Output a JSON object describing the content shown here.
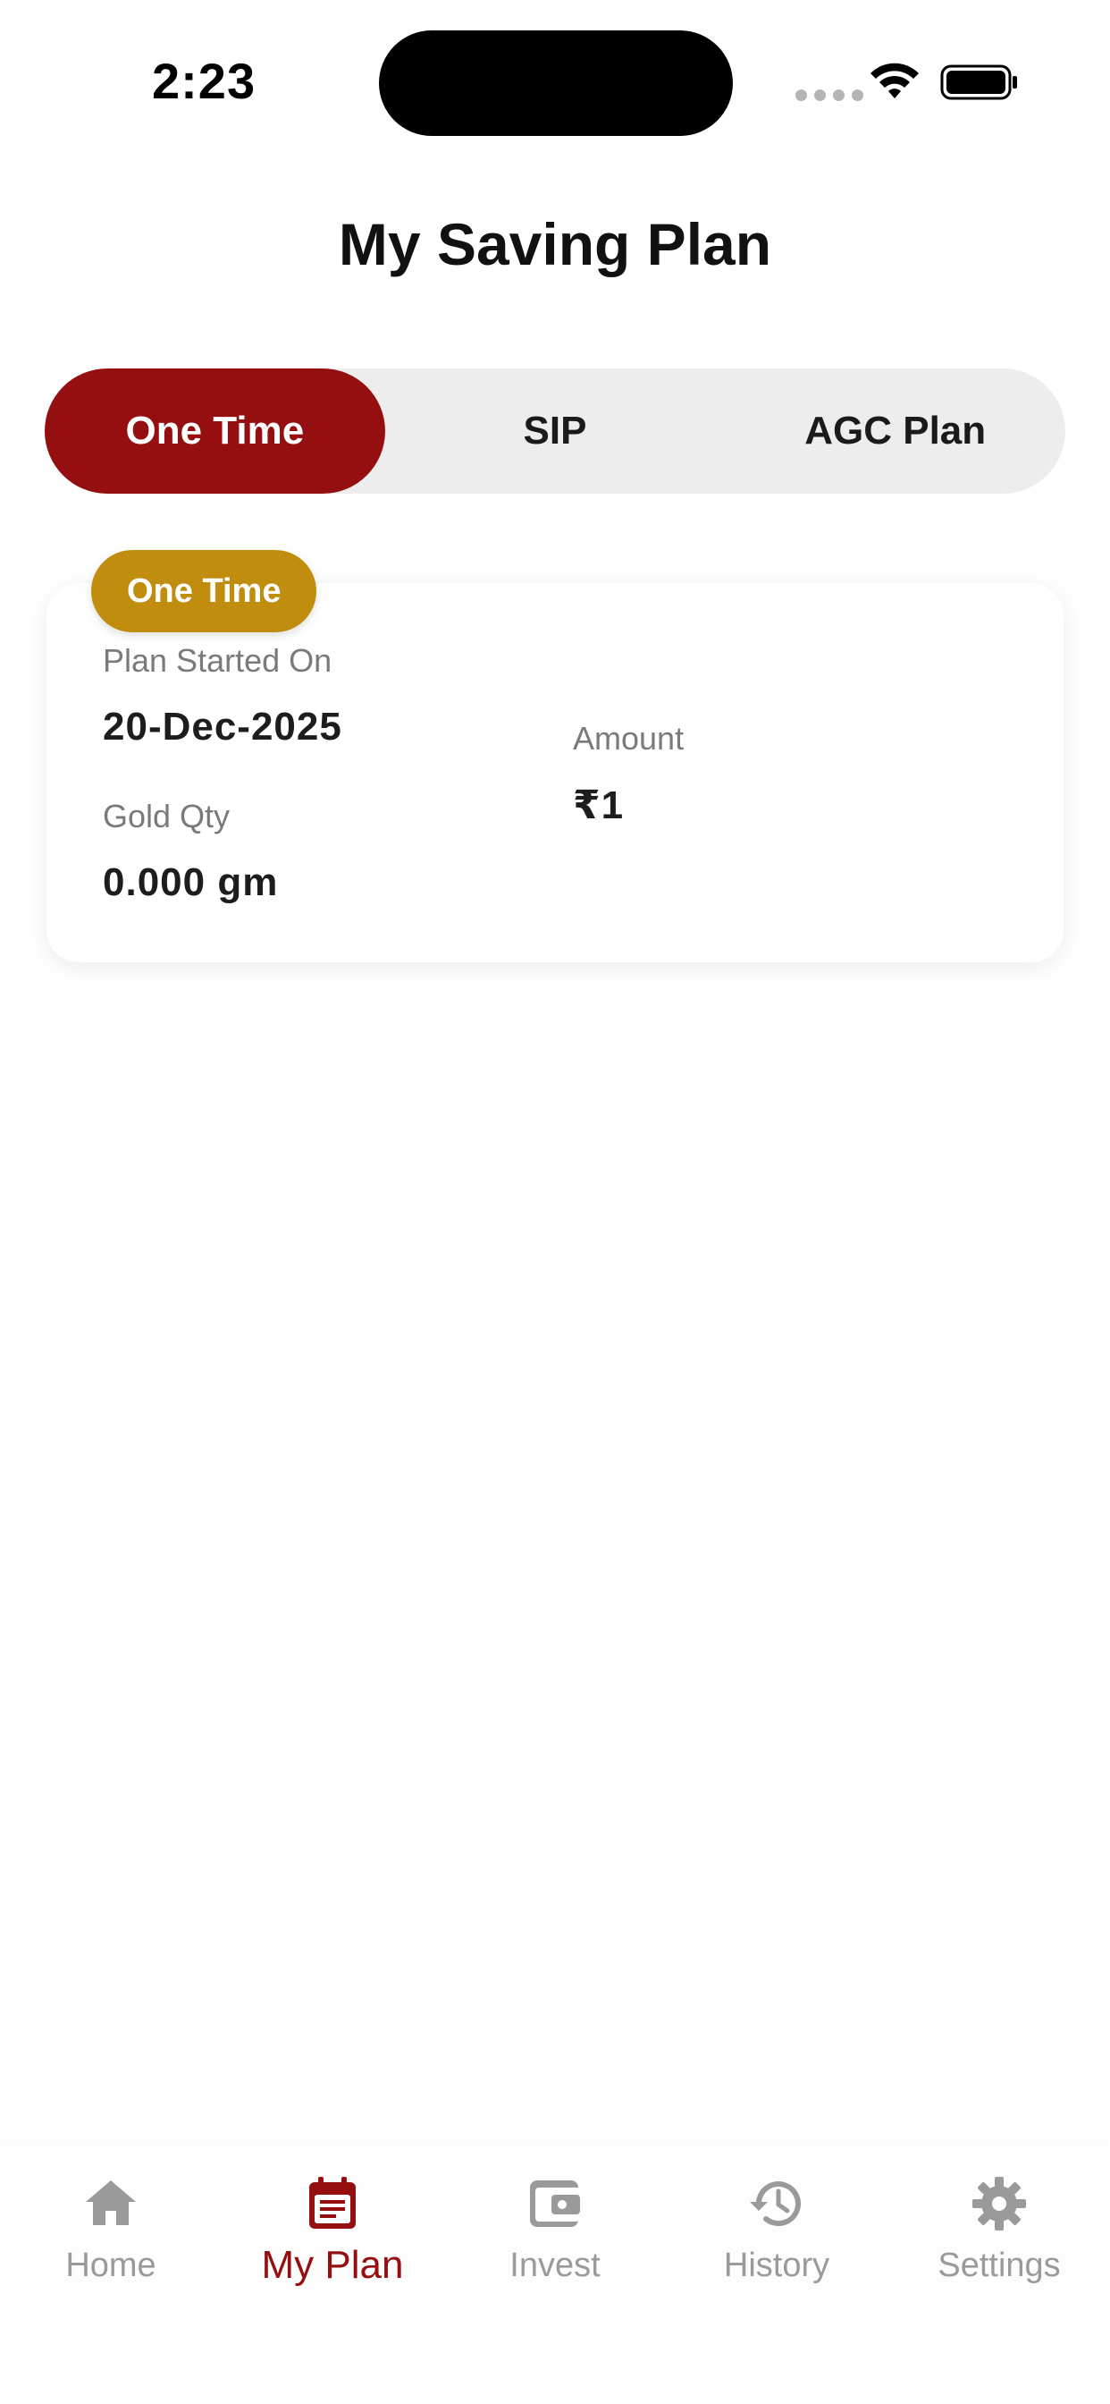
{
  "status_bar": {
    "time": "2:23",
    "wifi_icon": "wifi-icon",
    "battery_icon": "battery-icon"
  },
  "page": {
    "title": "My Saving Plan"
  },
  "tabs": [
    {
      "label": "One Time",
      "active": true
    },
    {
      "label": "SIP",
      "active": false
    },
    {
      "label": "AGC Plan",
      "active": false
    }
  ],
  "plan_card": {
    "badge": "One Time",
    "started_label": "Plan Started On",
    "started_value": "20-Dec-2025",
    "amount_label": "Amount",
    "amount_value": "₹1",
    "gold_label": "Gold Qty",
    "gold_value": "0.000 gm"
  },
  "bottom_nav": [
    {
      "label": "Home",
      "icon": "home-icon",
      "active": false
    },
    {
      "label": "My Plan",
      "icon": "calendar-icon",
      "active": true
    },
    {
      "label": "Invest",
      "icon": "wallet-icon",
      "active": false
    },
    {
      "label": "History",
      "icon": "history-icon",
      "active": false
    },
    {
      "label": "Settings",
      "icon": "gear-icon",
      "active": false
    }
  ],
  "colors": {
    "accent": "#960f10",
    "badge": "#c18d0f",
    "inactive_nav": "#9a9a9a",
    "tab_track": "#ededed"
  }
}
